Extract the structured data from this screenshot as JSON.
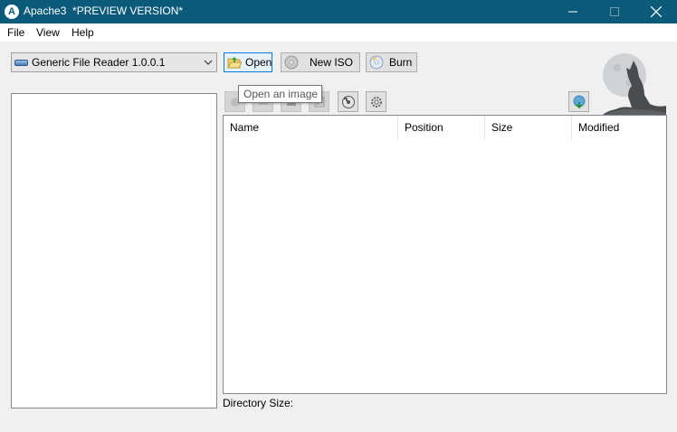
{
  "window": {
    "app_icon_letter": "A",
    "title": "Apache3  *PREVIEW VERSION*"
  },
  "menu": [
    "File",
    "View",
    "Help"
  ],
  "reader": {
    "selected": "Generic File Reader 1.0.0.1"
  },
  "toolbar": {
    "open_label": "Open",
    "new_iso_label": "New ISO",
    "burn_label": "Burn"
  },
  "tooltip": "Open an image",
  "file_list": {
    "columns": [
      "Name",
      "Position",
      "Size",
      "Modified"
    ]
  },
  "status": {
    "directory_size_label": "Directory Size:"
  }
}
